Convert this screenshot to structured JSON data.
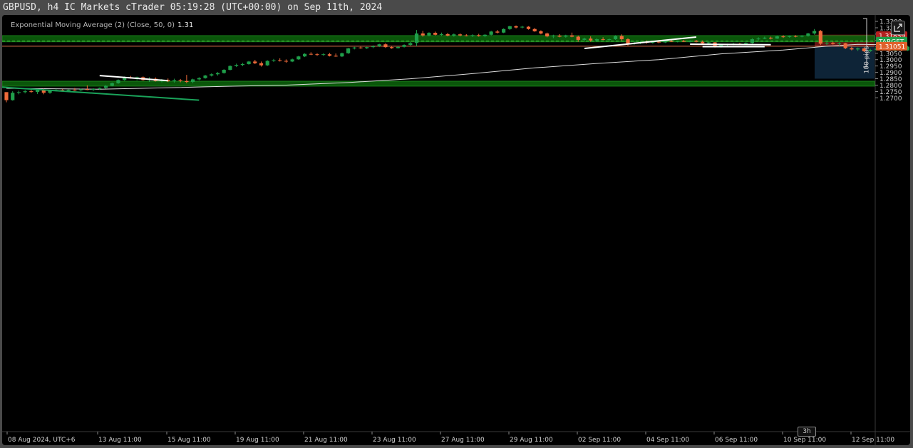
{
  "window": {
    "title": "GBPUSD, h4 IC Markets cTrader 05:19:28 (UTC+00:00) on Sep 11th, 2024"
  },
  "indicator": {
    "label": "Exponential Moving Average (2) (Close, 50, 0)",
    "value": "1.31"
  },
  "pips_label": "100 pips",
  "timeframe_badge": "3h",
  "colors": {
    "bull": "#1f9e4a",
    "bear": "#f06a3a",
    "zone": "#0b5e0b",
    "ema": "#dcdcdc",
    "price_line": "#e0704a",
    "tp_zone": "#0e2437",
    "sl_zone": "#6a1414"
  },
  "chart_data": {
    "type": "candlestick",
    "symbol": "GBPUSD",
    "timeframe": "h4",
    "ylim": [
      1.2665,
      1.3305
    ],
    "y_ticks": [
      "1.3300",
      "1.3250",
      "1.3200",
      "1.3150",
      "1.3100",
      "1.3050",
      "1.3000",
      "1.2950",
      "1.2900",
      "1.2850",
      "1.2800",
      "1.2750",
      "1.2700"
    ],
    "x_ticks": [
      "08 Aug 2024, UTC+6",
      "13 Aug 11:00",
      "15 Aug 11:00",
      "19 Aug 11:00",
      "21 Aug 11:00",
      "23 Aug 11:00",
      "27 Aug 11:00",
      "29 Aug 11:00",
      "02 Sep 11:00",
      "04 Sep 11:00",
      "06 Sep 11:00",
      "10 Sep 11:00",
      "12 Sep 11:00"
    ],
    "price_labels": {
      "sl": "1.31859",
      "target": "TARGET",
      "current": "1.31051"
    },
    "current_price": 1.31051,
    "candles": [
      [
        1.2745,
        1.2745,
        1.2665,
        1.2682
      ],
      [
        1.2682,
        1.2752,
        1.2678,
        1.274
      ],
      [
        1.274,
        1.2756,
        1.2728,
        1.2745
      ],
      [
        1.2745,
        1.2762,
        1.2735,
        1.2752
      ],
      [
        1.2752,
        1.2768,
        1.274,
        1.2746
      ],
      [
        1.2746,
        1.277,
        1.273,
        1.2766
      ],
      [
        1.2766,
        1.2772,
        1.2728,
        1.274
      ],
      [
        1.274,
        1.2762,
        1.2732,
        1.2758
      ],
      [
        1.2758,
        1.277,
        1.275,
        1.2762
      ],
      [
        1.2762,
        1.2768,
        1.2752,
        1.2756
      ],
      [
        1.2756,
        1.2768,
        1.275,
        1.2764
      ],
      [
        1.2764,
        1.2778,
        1.2755,
        1.276
      ],
      [
        1.276,
        1.2772,
        1.2752,
        1.2768
      ],
      [
        1.2768,
        1.2798,
        1.276,
        1.2762
      ],
      [
        1.2762,
        1.2775,
        1.2755,
        1.277
      ],
      [
        1.277,
        1.2782,
        1.2762,
        1.2778
      ],
      [
        1.2778,
        1.28,
        1.2772,
        1.2795
      ],
      [
        1.2795,
        1.282,
        1.279,
        1.2815
      ],
      [
        1.2815,
        1.2845,
        1.281,
        1.284
      ],
      [
        1.284,
        1.2868,
        1.2835,
        1.2862
      ],
      [
        1.2862,
        1.2872,
        1.285,
        1.2858
      ],
      [
        1.2858,
        1.2866,
        1.2838,
        1.2862
      ],
      [
        1.2862,
        1.2868,
        1.2835,
        1.284
      ],
      [
        1.284,
        1.2862,
        1.2825,
        1.285
      ],
      [
        1.285,
        1.286,
        1.2828,
        1.2832
      ],
      [
        1.2832,
        1.2848,
        1.2822,
        1.284
      ],
      [
        1.284,
        1.2852,
        1.2824,
        1.283
      ],
      [
        1.283,
        1.285,
        1.282,
        1.2838
      ],
      [
        1.2838,
        1.2848,
        1.2822,
        1.2832
      ],
      [
        1.2832,
        1.288,
        1.2815,
        1.2825
      ],
      [
        1.2825,
        1.285,
        1.2815,
        1.2845
      ],
      [
        1.2845,
        1.2862,
        1.2838,
        1.2855
      ],
      [
        1.2855,
        1.288,
        1.285,
        1.2875
      ],
      [
        1.2875,
        1.2892,
        1.2868,
        1.2885
      ],
      [
        1.2885,
        1.2902,
        1.2875,
        1.2895
      ],
      [
        1.2895,
        1.2925,
        1.289,
        1.292
      ],
      [
        1.292,
        1.2955,
        1.2915,
        1.295
      ],
      [
        1.295,
        1.2968,
        1.2942,
        1.2958
      ],
      [
        1.2958,
        1.2975,
        1.2948,
        1.2965
      ],
      [
        1.2965,
        1.299,
        1.296,
        1.2985
      ],
      [
        1.2985,
        1.2998,
        1.2965,
        1.2972
      ],
      [
        1.2972,
        1.2985,
        1.2945,
        1.2955
      ],
      [
        1.2955,
        1.2995,
        1.295,
        1.299
      ],
      [
        1.299,
        1.3005,
        1.2982,
        1.2995
      ],
      [
        1.2995,
        1.301,
        1.2985,
        1.299
      ],
      [
        1.299,
        1.3002,
        1.2975,
        1.2985
      ],
      [
        1.2985,
        1.3008,
        1.298,
        1.3002
      ],
      [
        1.3002,
        1.303,
        1.2998,
        1.3025
      ],
      [
        1.3025,
        1.305,
        1.302,
        1.3045
      ],
      [
        1.3045,
        1.3058,
        1.3035,
        1.3042
      ],
      [
        1.3042,
        1.305,
        1.303,
        1.304
      ],
      [
        1.304,
        1.305,
        1.303,
        1.3042
      ],
      [
        1.3042,
        1.3052,
        1.3025,
        1.303
      ],
      [
        1.303,
        1.3048,
        1.3022,
        1.3025
      ],
      [
        1.3025,
        1.3055,
        1.302,
        1.305
      ],
      [
        1.305,
        1.3092,
        1.3045,
        1.3088
      ],
      [
        1.3088,
        1.31,
        1.308,
        1.3095
      ],
      [
        1.3095,
        1.3102,
        1.3085,
        1.309
      ],
      [
        1.309,
        1.31,
        1.3083,
        1.3098
      ],
      [
        1.3098,
        1.3112,
        1.309,
        1.3105
      ],
      [
        1.3105,
        1.3125,
        1.3098,
        1.312
      ],
      [
        1.312,
        1.3128,
        1.3092,
        1.3098
      ],
      [
        1.3098,
        1.3108,
        1.3085,
        1.309
      ],
      [
        1.309,
        1.3105,
        1.3086,
        1.31
      ],
      [
        1.31,
        1.312,
        1.3095,
        1.3115
      ],
      [
        1.3115,
        1.3138,
        1.3108,
        1.313
      ],
      [
        1.313,
        1.3232,
        1.3105,
        1.3205
      ],
      [
        1.3205,
        1.3225,
        1.318,
        1.319
      ],
      [
        1.319,
        1.3215,
        1.3182,
        1.321
      ],
      [
        1.321,
        1.322,
        1.319,
        1.3195
      ],
      [
        1.3195,
        1.3212,
        1.3185,
        1.32
      ],
      [
        1.32,
        1.321,
        1.3182,
        1.3188
      ],
      [
        1.3188,
        1.3205,
        1.318,
        1.3198
      ],
      [
        1.3198,
        1.3206,
        1.3182,
        1.319
      ],
      [
        1.319,
        1.32,
        1.3182,
        1.3185
      ],
      [
        1.3185,
        1.3198,
        1.3178,
        1.3192
      ],
      [
        1.3192,
        1.3202,
        1.318,
        1.3185
      ],
      [
        1.3185,
        1.32,
        1.3176,
        1.3195
      ],
      [
        1.3195,
        1.3226,
        1.319,
        1.322
      ],
      [
        1.322,
        1.3232,
        1.3205,
        1.3212
      ],
      [
        1.3212,
        1.3245,
        1.3208,
        1.324
      ],
      [
        1.324,
        1.3266,
        1.3232,
        1.3262
      ],
      [
        1.3262,
        1.3268,
        1.3245,
        1.3252
      ],
      [
        1.3252,
        1.3265,
        1.3245,
        1.3258
      ],
      [
        1.3258,
        1.3262,
        1.3235,
        1.324
      ],
      [
        1.324,
        1.3248,
        1.3218,
        1.3222
      ],
      [
        1.3222,
        1.323,
        1.3198,
        1.3205
      ],
      [
        1.3205,
        1.3212,
        1.3175,
        1.3182
      ],
      [
        1.3182,
        1.3195,
        1.3168,
        1.3188
      ],
      [
        1.3188,
        1.32,
        1.3175,
        1.318
      ],
      [
        1.318,
        1.3195,
        1.3172,
        1.319
      ],
      [
        1.319,
        1.3212,
        1.3175,
        1.318
      ],
      [
        1.318,
        1.3188,
        1.314,
        1.3155
      ],
      [
        1.3155,
        1.3172,
        1.3145,
        1.3165
      ],
      [
        1.3165,
        1.3182,
        1.314,
        1.315
      ],
      [
        1.315,
        1.3168,
        1.3142,
        1.316
      ],
      [
        1.316,
        1.3175,
        1.3152,
        1.3155
      ],
      [
        1.3155,
        1.3165,
        1.3145,
        1.316
      ],
      [
        1.316,
        1.3192,
        1.3155,
        1.3185
      ],
      [
        1.3185,
        1.3198,
        1.315,
        1.316
      ],
      [
        1.316,
        1.3168,
        1.311,
        1.3125
      ],
      [
        1.3125,
        1.314,
        1.3115,
        1.313
      ],
      [
        1.313,
        1.3145,
        1.3122,
        1.3138
      ],
      [
        1.3138,
        1.315,
        1.3125,
        1.3132
      ],
      [
        1.3132,
        1.3145,
        1.3125,
        1.314
      ],
      [
        1.314,
        1.3148,
        1.3128,
        1.3135
      ],
      [
        1.3135,
        1.3152,
        1.313,
        1.3145
      ],
      [
        1.3145,
        1.3158,
        1.3138,
        1.3142
      ],
      [
        1.3142,
        1.315,
        1.3135,
        1.3147
      ],
      [
        1.3147,
        1.3155,
        1.3138,
        1.314
      ],
      [
        1.314,
        1.3152,
        1.3135,
        1.3148
      ],
      [
        1.3148,
        1.3155,
        1.3135,
        1.314
      ],
      [
        1.314,
        1.315,
        1.312,
        1.3128
      ],
      [
        1.3128,
        1.314,
        1.312,
        1.3135
      ],
      [
        1.3135,
        1.3138,
        1.3095,
        1.3105
      ],
      [
        1.3105,
        1.312,
        1.3095,
        1.3115
      ],
      [
        1.3115,
        1.3125,
        1.3108,
        1.312
      ],
      [
        1.312,
        1.313,
        1.3112,
        1.3125
      ],
      [
        1.3125,
        1.3132,
        1.3115,
        1.3118
      ],
      [
        1.3118,
        1.3135,
        1.3115,
        1.313
      ],
      [
        1.313,
        1.3168,
        1.3125,
        1.316
      ],
      [
        1.316,
        1.3175,
        1.315,
        1.3165
      ],
      [
        1.3165,
        1.318,
        1.316,
        1.3172
      ],
      [
        1.3172,
        1.318,
        1.3158,
        1.3165
      ],
      [
        1.3165,
        1.3188,
        1.3162,
        1.3182
      ],
      [
        1.3182,
        1.3192,
        1.317,
        1.3178
      ],
      [
        1.3178,
        1.319,
        1.3172,
        1.3185
      ],
      [
        1.3185,
        1.3192,
        1.3175,
        1.3182
      ],
      [
        1.3182,
        1.3192,
        1.3175,
        1.3186
      ],
      [
        1.3186,
        1.321,
        1.318,
        1.3205
      ],
      [
        1.3205,
        1.324,
        1.3195,
        1.3225
      ],
      [
        1.3225,
        1.3232,
        1.3115,
        1.3125
      ],
      [
        1.3125,
        1.314,
        1.3115,
        1.313
      ],
      [
        1.313,
        1.314,
        1.3118,
        1.3122
      ],
      [
        1.3122,
        1.3135,
        1.311,
        1.3128
      ],
      [
        1.3128,
        1.3132,
        1.3082,
        1.309
      ],
      [
        1.309,
        1.31,
        1.3072,
        1.308
      ],
      [
        1.308,
        1.3095,
        1.3068,
        1.3088
      ],
      [
        1.3088,
        1.3096,
        1.306,
        1.3066
      ],
      [
        1.3066,
        1.3085,
        1.306,
        1.3075
      ],
      [
        1.3075,
        1.3095,
        1.3068,
        1.3088
      ],
      [
        1.3088,
        1.3102,
        1.307,
        1.3078
      ],
      [
        1.3078,
        1.309,
        1.3052,
        1.307
      ],
      [
        1.307,
        1.3085,
        1.3062,
        1.308
      ],
      [
        1.308,
        1.309,
        1.3066,
        1.3072
      ],
      [
        1.3072,
        1.3108,
        1.3068,
        1.3102
      ]
    ],
    "ema50": [
      [
        0,
        1.2775
      ],
      [
        15,
        1.2768
      ],
      [
        25,
        1.2778
      ],
      [
        35,
        1.279
      ],
      [
        45,
        1.28
      ],
      [
        55,
        1.282
      ],
      [
        65,
        1.285
      ],
      [
        75,
        1.289
      ],
      [
        85,
        1.2935
      ],
      [
        95,
        1.297
      ],
      [
        105,
        1.3
      ],
      [
        115,
        1.3045
      ],
      [
        125,
        1.3075
      ],
      [
        132,
        1.3105
      ],
      [
        137,
        1.312
      ],
      [
        140,
        1.3118
      ]
    ],
    "zones": [
      {
        "top": 1.31881,
        "bottom": 1.31397
      },
      {
        "top": 1.28306,
        "bottom": 1.27921
      }
    ],
    "target_level": 1.31447,
    "sl_zone": {
      "top": 1.31959,
      "bottom": 1.31051
    },
    "tp_zone": {
      "top": 1.31051,
      "bottom": 1.28504
    },
    "trendlines": [
      {
        "color": "#1aa35a",
        "from": [
          -1,
          1.2785
        ],
        "to": [
          31,
          1.2682
        ]
      },
      {
        "color": "#ffffff",
        "from": [
          15,
          1.2875
        ],
        "to": [
          26,
          1.2835
        ]
      },
      {
        "color": "#ffffff",
        "from": [
          93,
          1.3088
        ],
        "to": [
          111,
          1.3177
        ]
      },
      {
        "color": "#ffffff",
        "from": [
          110,
          1.3121
        ],
        "to": [
          123,
          1.3117
        ]
      },
      {
        "color": "#ffffff",
        "from": [
          112,
          1.3102
        ],
        "to": [
          122,
          1.3102
        ]
      }
    ]
  }
}
